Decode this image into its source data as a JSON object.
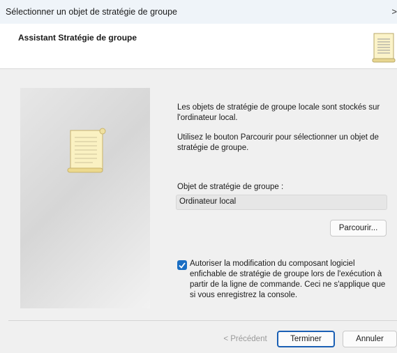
{
  "window": {
    "title": "Sélectionner un objet de stratégie de groupe",
    "close_glyph": ">"
  },
  "header": {
    "title": "Assistant Stratégie de groupe",
    "icon": "scroll-document-icon"
  },
  "body": {
    "info_line1": "Les objets de stratégie de groupe locale sont stockés sur l'ordinateur local.",
    "info_line2": "Utilisez le bouton Parcourir pour sélectionner un objet de stratégie de groupe.",
    "gpo_label": "Objet de stratégie de groupe :",
    "gpo_value": "Ordinateur local",
    "browse_label": "Parcourir...",
    "checkbox_label": "Autoriser la modification du composant logiciel enfichable de stratégie de groupe lors de l'exécution à partir de la ligne de commande. Ceci ne s'applique que si vous enregistrez la console.",
    "checkbox_checked": true
  },
  "footer": {
    "prev_label": "< Précédent",
    "finish_label": "Terminer",
    "cancel_label": "Annuler"
  },
  "colors": {
    "accent": "#1a6ec3",
    "focus_border": "#1a5fb4"
  }
}
